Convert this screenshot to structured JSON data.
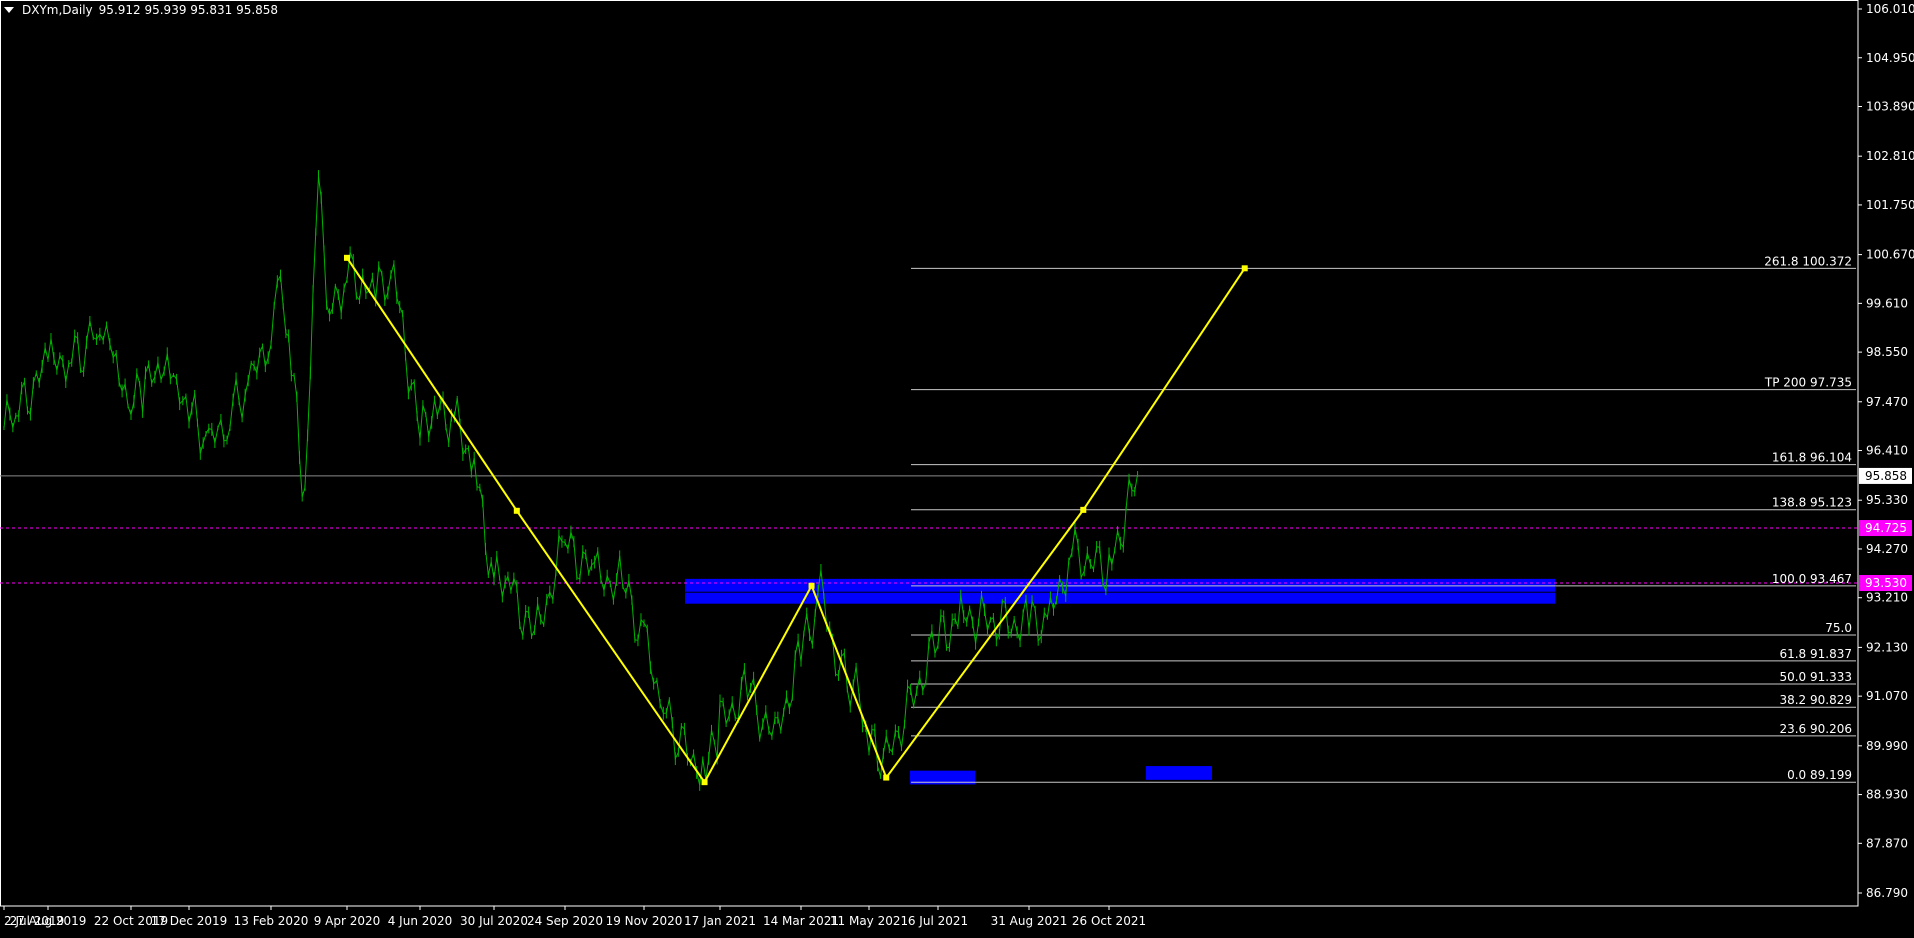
{
  "header": {
    "symbol": "DXYm,Daily",
    "ohlc": "95.912 95.939 95.831 95.858"
  },
  "colors": {
    "background": "#000000",
    "candles": "#00b400",
    "zigzag": "#ffff00",
    "fib_lines": "#c8c8c8",
    "zones": "#0000ff",
    "price_marker": "#ff00ff",
    "axis": "#ffffff"
  },
  "chart_data": {
    "type": "line",
    "title": "",
    "ylim": [
      86.4,
      106.3
    ],
    "y_ticks": [
      "106.010",
      "104.950",
      "103.890",
      "102.810",
      "101.750",
      "100.670",
      "99.610",
      "98.550",
      "97.470",
      "96.410",
      "95.330",
      "94.270",
      "93.210",
      "92.130",
      "91.070",
      "89.990",
      "88.930",
      "87.870",
      "86.790"
    ],
    "x_ticks": [
      "2 Jul 2019",
      "27 Aug 2019",
      "22 Oct 2019",
      "17 Dec 2019",
      "13 Feb 2020",
      "9 Apr 2020",
      "4 Jun 2020",
      "30 Jul 2020",
      "24 Sep 2020",
      "19 Nov 2020",
      "17 Jan 2021",
      "14 Mar 2021",
      "11 May 2021",
      "6 Jul 2021",
      "31 Aug 2021",
      "26 Oct 2021"
    ],
    "series": [
      {
        "points": [
          [
            "2 Jul 2019",
            96.9
          ],
          [
            "17 Jul 2019",
            97.2
          ],
          [
            "27 Aug 2019",
            98.3
          ],
          [
            "10 Sep 2019",
            98.4
          ],
          [
            "22 Sep 2019",
            98.6
          ],
          [
            "1 Oct 2019",
            99.1
          ],
          [
            "10 Oct 2019",
            98.2
          ],
          [
            "22 Oct 2019",
            97.4
          ],
          [
            "5 Nov 2019",
            97.8
          ],
          [
            "20 Nov 2019",
            98.2
          ],
          [
            "2 Dec 2019",
            97.7
          ],
          [
            "17 Dec 2019",
            97.3
          ],
          [
            "31 Dec 2019",
            96.5
          ],
          [
            "15 Jan 2020",
            97.2
          ],
          [
            "30 Jan 2020",
            97.9
          ],
          [
            "13 Feb 2020",
            99.0
          ],
          [
            "20 Feb 2020",
            99.8
          ],
          [
            "28 Feb 2020",
            98.3
          ],
          [
            "9 Mar 2020",
            95.2
          ],
          [
            "19 Mar 2020",
            102.6
          ],
          [
            "25 Mar 2020",
            99.2
          ],
          [
            "9 Apr 2020",
            100.3
          ],
          [
            "21 Apr 2020",
            99.9
          ],
          [
            "1 May 2020",
            99.8
          ],
          [
            "15 May 2020",
            100.2
          ],
          [
            "4 Jun 2020",
            96.7
          ],
          [
            "15 Jun 2020",
            97.3
          ],
          [
            "30 Jun 2020",
            97.1
          ],
          [
            "15 Jul 2020",
            96.1
          ],
          [
            "30 Jul 2020",
            93.5
          ],
          [
            "10 Aug 2020",
            93.6
          ],
          [
            "31 Aug 2020",
            92.3
          ],
          [
            "24 Sep 2020",
            94.4
          ],
          [
            "15 Oct 2020",
            93.7
          ],
          [
            "4 Nov 2020",
            93.5
          ],
          [
            "19 Nov 2020",
            92.3
          ],
          [
            "4 Dec 2020",
            90.8
          ],
          [
            "18 Dec 2020",
            90.0
          ],
          [
            "6 Jan 2021",
            89.4
          ],
          [
            "17 Jan 2021",
            90.5
          ],
          [
            "5 Feb 2021",
            91.2
          ],
          [
            "24 Feb 2021",
            90.1
          ],
          [
            "14 Mar 2021",
            92.0
          ],
          [
            "31 Mar 2021",
            93.3
          ],
          [
            "15 Apr 2021",
            91.7
          ],
          [
            "30 Apr 2021",
            91.2
          ],
          [
            "11 May 2021",
            90.0
          ],
          [
            "25 May 2021",
            89.7
          ],
          [
            "6 Jul 2021",
            92.3
          ],
          [
            "20 Jul 2021",
            92.8
          ],
          [
            "31 Aug 2021",
            92.6
          ],
          [
            "15 Sep 2021",
            92.8
          ],
          [
            "30 Sep 2021",
            94.2
          ],
          [
            "26 Oct 2021",
            93.8
          ],
          [
            "15 Nov 2021",
            95.9
          ]
        ]
      }
    ],
    "zigzag": [
      [
        "9 Apr 2020",
        100.6
      ],
      [
        "17 Aug 2020",
        95.1
      ],
      [
        "5 Jan 2021",
        89.2
      ],
      [
        "23 Mar 2021",
        93.47
      ],
      [
        "25 May 2021",
        89.3
      ],
      [
        "8 Oct 2021",
        95.12
      ],
      [
        "29 Jan 2022",
        100.372
      ]
    ],
    "fib_levels": [
      {
        "label": "261.8 100.372",
        "price": 100.372
      },
      {
        "label": "TP 200 97.735",
        "price": 97.735
      },
      {
        "label": "161.8 96.104",
        "price": 96.104
      },
      {
        "label": "138.8 95.123",
        "price": 95.123
      },
      {
        "label": "100.0 93.467",
        "price": 93.467
      },
      {
        "label": "75.0",
        "price": 92.4
      },
      {
        "label": "61.8 91.837",
        "price": 91.837
      },
      {
        "label": "50.0 91.333",
        "price": 91.333
      },
      {
        "label": "38.2 90.829",
        "price": 90.829
      },
      {
        "label": "23.6 90.206",
        "price": 90.206
      },
      {
        "label": "0.0 89.199",
        "price": 89.199
      }
    ],
    "current_price": "95.858",
    "current_price_value": 95.858,
    "marker_lines": [
      {
        "label": "94.725",
        "price": 94.725
      },
      {
        "label": "93.530",
        "price": 93.53
      }
    ]
  }
}
